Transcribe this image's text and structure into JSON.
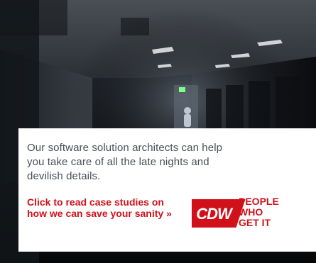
{
  "ad": {
    "body_copy": "Our software solution architects can help you take care of all the late nights and devilish details.",
    "cta": "Click to read case studies on how we can save your sanity »",
    "brand": {
      "logo_text": "CDW",
      "tagline_line1": "PEOPLE",
      "tagline_line2": "WHO",
      "tagline_line3": "GET IT"
    },
    "colors": {
      "brand_red": "#d1111a",
      "panel_bg": "#ffffff",
      "text_gray": "#4a4f55",
      "photo_dark": "#0f1216"
    }
  }
}
